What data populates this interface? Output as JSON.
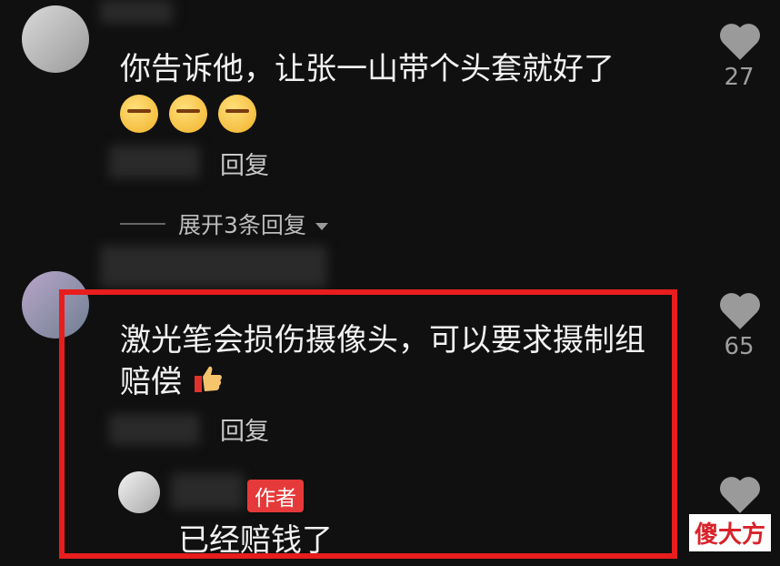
{
  "comments": [
    {
      "text": "你告诉他，让张一山带个头套就好了",
      "reply_label": "回复",
      "likes": "27",
      "emoji_count": 3,
      "expand_label": "展开3条回复"
    },
    {
      "text_line1": "激光笔会损伤摄像头，可以要求摄制组",
      "text_line2": "赔偿",
      "reply_label": "回复",
      "likes": "65",
      "author_reply": {
        "tag": "作者",
        "text": "已经赔钱了"
      }
    }
  ],
  "watermark": "傻大方",
  "colors": {
    "highlight": "#e81d1d",
    "author_tag": "#e63a3a"
  },
  "icons": {
    "like": "heart-icon",
    "expand": "caret-down-icon",
    "thumbs": "thumbs-up-icon"
  }
}
